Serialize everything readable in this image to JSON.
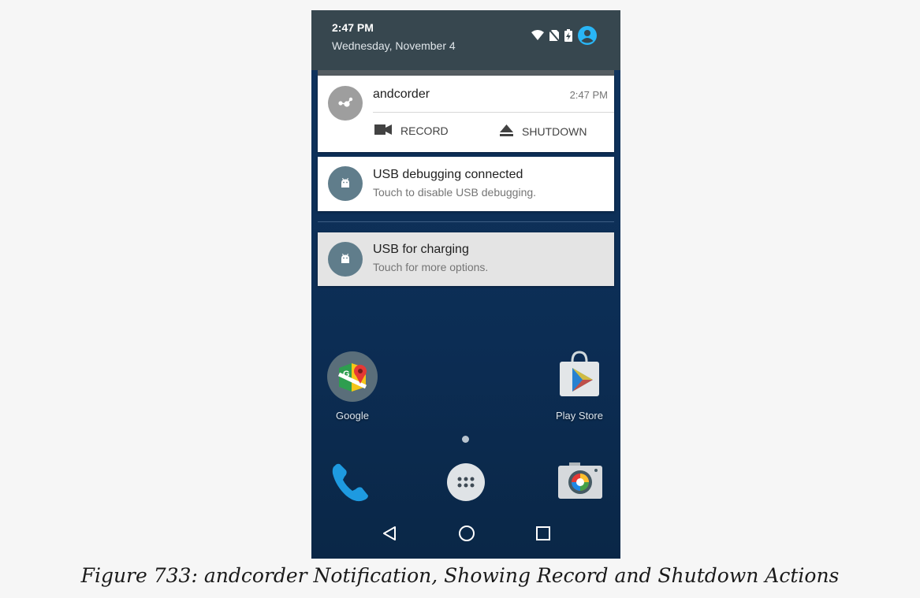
{
  "status_bar": {
    "time": "2:47 PM",
    "date": "Wednesday, November 4",
    "icons": [
      "wifi-icon",
      "no-sim-icon",
      "battery-charging-icon",
      "account-icon"
    ]
  },
  "notifications": [
    {
      "app": "andcorder",
      "time": "2:47 PM",
      "icon": "share-node-icon",
      "actions": [
        {
          "label": "RECORD",
          "icon": "videocam-icon"
        },
        {
          "label": "SHUTDOWN",
          "icon": "eject-icon"
        }
      ]
    },
    {
      "title": "USB debugging connected",
      "text": "Touch to disable USB debugging.",
      "icon": "android-icon"
    },
    {
      "title": "USB for charging",
      "text": "Touch for more options.",
      "icon": "android-icon"
    }
  ],
  "home": {
    "apps": [
      {
        "label": "Google",
        "icon": "google-maps-folder-icon"
      },
      {
        "label": "Play Store",
        "icon": "play-store-icon"
      }
    ],
    "dock": [
      "phone-icon",
      "app-drawer-icon",
      "camera-icon"
    ]
  },
  "navbar": [
    "back-icon",
    "home-icon",
    "recents-icon"
  ],
  "colors": {
    "status_bar": "#37474f",
    "avatar_gray": "#9e9e9e",
    "avatar_slate": "#607d8b",
    "account_accent": "#29b6f6"
  },
  "caption": "Figure 733: andcorder Notification, Showing Record and Shutdown Actions"
}
